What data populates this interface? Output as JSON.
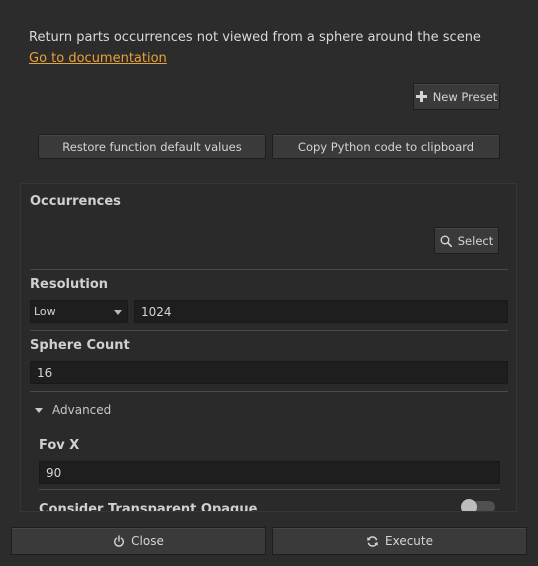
{
  "description": "Return parts occurrences not viewed from a sphere around the scene",
  "doc_link": "Go to documentation",
  "buttons": {
    "new_preset": "New Preset",
    "restore_defaults": "Restore function default values",
    "copy_python": "Copy Python code to clipboard",
    "select": "Select",
    "close": "Close",
    "execute": "Execute"
  },
  "params": {
    "occurrences": {
      "label": "Occurrences"
    },
    "resolution": {
      "label": "Resolution",
      "preset": "Low",
      "value": "1024"
    },
    "sphere_count": {
      "label": "Sphere Count",
      "value": "16"
    },
    "advanced": {
      "label": "Advanced",
      "expanded": true
    },
    "fov_x": {
      "label": "Fov X",
      "value": "90"
    },
    "consider_transparent_opaque": {
      "label": "Consider Transparent Opaque",
      "enabled": false
    }
  },
  "colors": {
    "link": "#e8a23a",
    "background": "#2c2c2c"
  },
  "icons": {
    "new_preset": "plus-icon",
    "select": "search-icon",
    "close": "power-icon",
    "execute": "refresh-icon",
    "advanced": "caret-down-icon"
  }
}
